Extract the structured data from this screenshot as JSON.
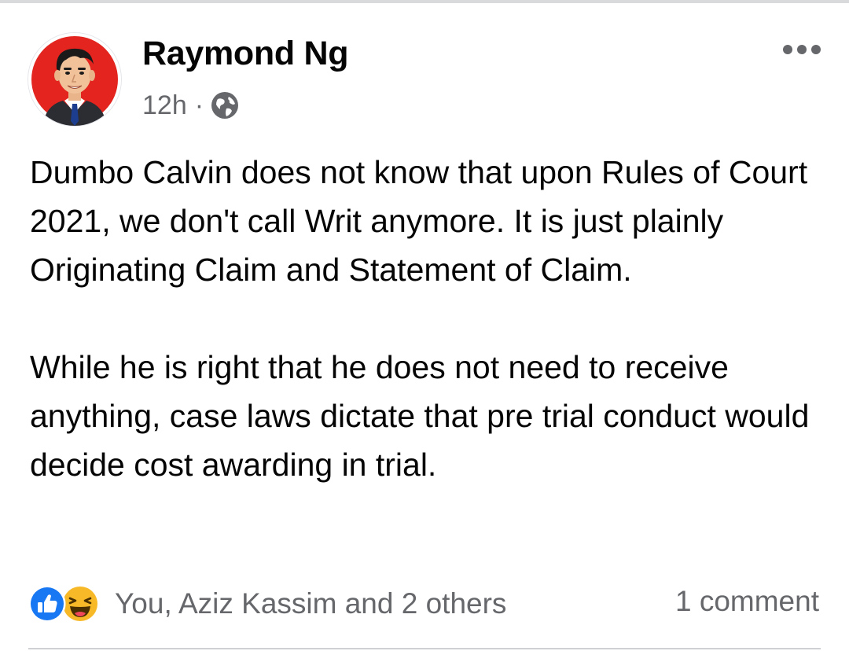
{
  "post": {
    "author": "Raymond Ng",
    "time": "12h",
    "separator": "·",
    "audience_icon": "globe-icon",
    "more_icon": "more-options-icon",
    "paragraphs": [
      "Dumbo Calvin does not know that upon Rules of Court 2021, we don't call Writ anymore. It is just plainly Originating Claim and Statement of Claim.",
      "While he is right that he does not need to receive anything, case laws dictate that pre trial conduct would decide cost awarding in trial."
    ],
    "reactions": {
      "icons": [
        "like-icon",
        "haha-icon"
      ],
      "summary": "You, Aziz Kassim and 2 others"
    },
    "comments": "1 comment"
  },
  "colors": {
    "text": "#050505",
    "secondary": "#65676b",
    "like_blue": "#1877f2",
    "haha_yellow": "#f7b928",
    "avatar_bg": "#e3241f"
  }
}
